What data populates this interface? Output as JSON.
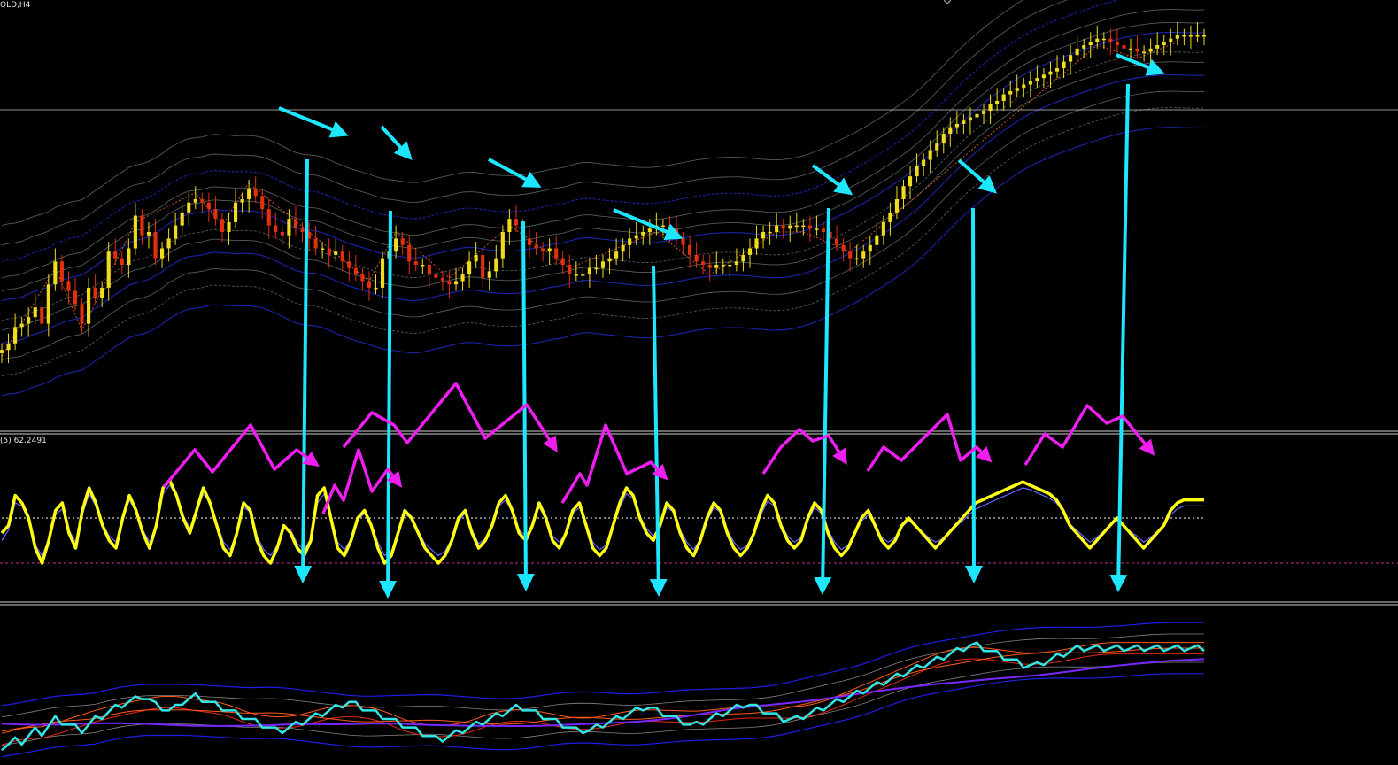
{
  "symbol_label": "OLD,H4",
  "indicator_label": "(5) 62.2491",
  "colors": {
    "background": "#000000",
    "bull_candle": "#f0dc1e",
    "bear_candle": "#e03010",
    "zigzag": "#c85a1e",
    "envelope_blue": "#1e2cd2",
    "envelope_gray": "#5a6464",
    "oscillator_main": "#ffff14",
    "oscillator_signal": "#6464ff",
    "oscillator_mid": "#ffffff",
    "level_line": "#c0309a",
    "annotation_cyan": "#1ee6ff",
    "annotation_magenta": "#ee1ef0",
    "lower_cyan": "#32e6e6",
    "lower_orange": "#ff5a14",
    "lower_red": "#e62814",
    "lower_blue": "#1e1ee6",
    "lower_violet": "#7828ff",
    "lower_gray": "#828282"
  },
  "chart_data": [
    {
      "type": "candlestick",
      "panel": "price",
      "title": "",
      "x": "bar index (0-180)",
      "close": [
        4,
        6,
        11,
        12,
        14,
        17,
        12,
        24,
        31,
        25,
        22,
        18,
        12,
        23,
        20,
        23,
        34,
        32,
        30,
        35,
        45,
        39,
        40,
        32,
        35,
        38,
        42,
        46,
        49,
        50,
        49,
        47,
        44,
        40,
        43,
        49,
        50,
        53,
        51,
        47,
        42,
        40,
        39,
        44,
        41,
        40,
        38,
        35,
        35,
        33,
        34,
        31,
        29,
        27,
        25,
        23,
        23,
        32,
        34,
        38,
        36,
        31,
        30,
        30,
        27,
        26,
        25,
        24,
        25,
        27,
        31,
        33,
        26,
        28,
        32,
        40,
        44,
        42,
        38,
        36,
        35,
        34,
        35,
        32,
        30,
        27,
        27,
        27,
        29,
        29,
        31,
        32,
        34,
        36,
        38,
        39,
        40,
        41,
        42,
        42,
        41,
        38,
        36,
        33,
        31,
        30,
        29,
        30,
        30,
        30,
        31,
        33,
        35,
        38,
        40,
        40,
        42,
        41,
        42,
        42,
        42,
        41,
        41,
        40,
        38,
        36,
        34,
        32,
        32,
        34,
        36,
        39,
        43,
        46,
        50,
        54,
        57,
        60,
        62,
        65,
        67,
        70,
        72,
        73,
        74,
        75,
        76,
        77,
        79,
        80,
        82,
        83,
        84,
        85,
        86,
        87,
        88,
        89,
        90,
        92,
        94,
        96,
        97,
        98,
        99,
        99,
        98,
        97,
        96,
        96,
        95,
        95,
        96,
        97,
        98,
        99,
        100,
        100,
        100,
        100,
        100
      ],
      "ylim": [
        0,
        100
      ]
    },
    {
      "type": "line",
      "panel": "oscillator",
      "series": [
        {
          "name": "",
          "role": "main",
          "values": [
            40,
            45,
            65,
            60,
            50,
            30,
            20,
            35,
            55,
            60,
            40,
            30,
            55,
            70,
            60,
            45,
            35,
            30,
            50,
            65,
            55,
            40,
            30,
            45,
            70,
            75,
            65,
            50,
            40,
            55,
            70,
            60,
            45,
            30,
            25,
            40,
            60,
            55,
            35,
            25,
            20,
            30,
            45,
            40,
            30,
            25,
            35,
            65,
            70,
            50,
            30,
            25,
            35,
            50,
            55,
            45,
            30,
            20,
            25,
            40,
            55,
            50,
            40,
            30,
            25,
            20,
            25,
            35,
            50,
            55,
            40,
            30,
            35,
            45,
            60,
            65,
            55,
            40,
            35,
            45,
            60,
            50,
            35,
            30,
            40,
            55,
            60,
            45,
            30,
            25,
            30,
            45,
            60,
            70,
            65,
            50,
            40,
            35,
            45,
            60,
            55,
            40,
            30,
            25,
            35,
            50,
            60,
            55,
            40,
            30,
            25,
            30,
            40,
            55,
            65,
            60,
            45,
            35,
            30,
            35,
            50,
            60,
            55,
            40,
            30,
            25,
            30,
            40,
            50,
            55,
            45,
            35,
            30,
            35,
            45,
            50,
            45,
            40,
            35,
            30,
            35,
            40,
            45,
            50,
            55,
            60,
            62,
            64,
            66,
            68,
            70,
            72,
            74,
            72,
            70,
            68,
            66,
            62,
            55,
            45,
            40,
            35,
            30,
            35,
            40,
            45,
            50,
            45,
            40,
            35,
            30,
            35,
            40,
            45,
            55,
            60,
            62,
            62,
            62,
            62
          ]
        },
        {
          "name": "",
          "role": "signal",
          "values": [
            35,
            42,
            60,
            58,
            48,
            32,
            25,
            36,
            52,
            56,
            42,
            34,
            52,
            66,
            58,
            46,
            38,
            34,
            48,
            62,
            54,
            42,
            34,
            46,
            66,
            72,
            64,
            52,
            43,
            54,
            66,
            60,
            47,
            34,
            29,
            40,
            57,
            54,
            38,
            29,
            25,
            32,
            44,
            42,
            33,
            29,
            36,
            60,
            66,
            51,
            34,
            29,
            36,
            49,
            53,
            46,
            34,
            25,
            28,
            40,
            52,
            50,
            41,
            33,
            29,
            25,
            28,
            36,
            48,
            53,
            42,
            33,
            36,
            45,
            58,
            62,
            54,
            42,
            38,
            45,
            57,
            50,
            38,
            34,
            40,
            53,
            57,
            46,
            34,
            29,
            32,
            44,
            57,
            66,
            63,
            51,
            43,
            38,
            45,
            57,
            54,
            42,
            34,
            29,
            36,
            48,
            57,
            54,
            42,
            34,
            29,
            32,
            40,
            52,
            61,
            58,
            46,
            38,
            34,
            37,
            48,
            57,
            53,
            42,
            34,
            29,
            32,
            40,
            48,
            52,
            45,
            37,
            34,
            37,
            44,
            48,
            45,
            41,
            37,
            34,
            36,
            40,
            44,
            48,
            52,
            56,
            58,
            60,
            62,
            64,
            66,
            68,
            70,
            69,
            67,
            65,
            63,
            60,
            54,
            46,
            42,
            38,
            34,
            37,
            41,
            45,
            48,
            45,
            41,
            38,
            34,
            37,
            41,
            45,
            52,
            56,
            58,
            58,
            58,
            58
          ]
        },
        {
          "name": "",
          "role": "mid",
          "values": [
            50,
            50,
            50,
            50,
            50,
            50,
            50,
            50,
            50,
            50,
            50,
            50,
            50,
            50,
            50,
            50,
            50,
            50,
            50,
            50,
            50,
            50,
            50,
            50,
            50,
            50,
            50,
            50,
            50,
            50,
            50,
            50,
            50,
            50,
            50,
            50,
            50,
            50,
            50,
            50,
            50,
            50,
            50,
            50,
            50,
            50,
            50,
            50,
            50,
            50,
            50,
            50,
            50,
            50,
            50,
            50,
            50,
            50,
            50,
            50,
            50,
            50,
            50,
            50,
            50,
            50,
            50,
            50,
            50,
            50,
            50,
            50,
            50,
            50,
            50,
            50,
            50,
            50,
            50,
            50,
            50,
            50,
            50,
            50,
            50,
            50,
            50,
            50,
            50,
            50,
            50,
            50,
            50,
            50,
            50,
            50,
            50,
            50,
            50,
            50,
            50,
            50,
            50,
            50,
            50,
            50,
            50,
            50,
            50,
            50,
            50,
            50,
            50,
            50,
            50,
            50,
            50,
            50,
            50,
            50,
            50,
            50,
            50,
            50,
            50,
            50,
            50,
            50,
            50,
            50,
            50,
            50,
            50,
            50,
            50,
            50,
            50,
            50,
            50,
            50,
            50,
            50,
            50,
            50,
            50,
            50,
            50,
            50,
            50,
            50,
            50,
            50,
            50,
            50,
            50,
            50,
            50,
            50,
            50,
            50,
            50,
            50,
            50,
            50,
            50,
            50,
            50,
            50,
            50,
            50,
            50,
            50,
            50,
            50,
            50,
            50,
            50,
            50,
            50,
            50,
            50
          ]
        }
      ],
      "level": 20,
      "ylim": [
        0,
        100
      ]
    },
    {
      "type": "line",
      "panel": "lower",
      "series": [
        {
          "name": "",
          "role": "main",
          "values": [
            10,
            12,
            15,
            14,
            18,
            22,
            20,
            25,
            30,
            28,
            26,
            24,
            22,
            26,
            30,
            32,
            35,
            38,
            40,
            42,
            44,
            46,
            44,
            40,
            38,
            36,
            38,
            42,
            44,
            46,
            44,
            42,
            40,
            38,
            36,
            34,
            32,
            30,
            28,
            26,
            24,
            22,
            22,
            24,
            26,
            28,
            30,
            32,
            34,
            36,
            38,
            40,
            42,
            40,
            38,
            36,
            34,
            32,
            30,
            28,
            26,
            24,
            22,
            20,
            18,
            16,
            16,
            18,
            20,
            22,
            24,
            26,
            28,
            30,
            32,
            34,
            36,
            38,
            38,
            36,
            34,
            32,
            30,
            28,
            26,
            24,
            22,
            22,
            22,
            24,
            26,
            28,
            30,
            32,
            34,
            36,
            38,
            38,
            36,
            34,
            32,
            30,
            28,
            26,
            26,
            28,
            30,
            32,
            34,
            36,
            38,
            40,
            40,
            38,
            36,
            34,
            32,
            30,
            30,
            30,
            32,
            34,
            36,
            38,
            40,
            42,
            44,
            46,
            48,
            50,
            52,
            54,
            56,
            58,
            60,
            62,
            64,
            66,
            68,
            70,
            72,
            74,
            76,
            78,
            80,
            82,
            82,
            80,
            78,
            76,
            74,
            72,
            70,
            68,
            68,
            68,
            70,
            72,
            74,
            76,
            78,
            80,
            80,
            80,
            80,
            80,
            80,
            80,
            80,
            80,
            80,
            80,
            80,
            80,
            80,
            80,
            80,
            80,
            80,
            80,
            80
          ]
        }
      ],
      "ylim": [
        0,
        100
      ]
    }
  ]
}
